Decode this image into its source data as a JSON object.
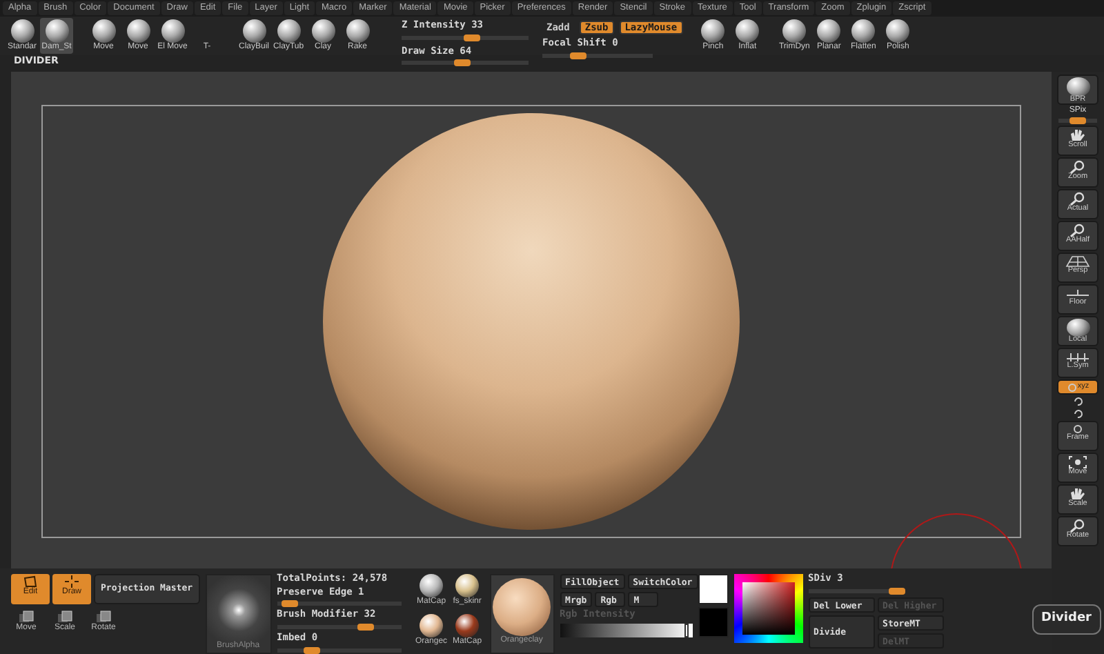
{
  "menu": [
    "Alpha",
    "Brush",
    "Color",
    "Document",
    "Draw",
    "Edit",
    "File",
    "Layer",
    "Light",
    "Macro",
    "Marker",
    "Material",
    "Movie",
    "Picker",
    "Preferences",
    "Render",
    "Stencil",
    "Stroke",
    "Texture",
    "Tool",
    "Transform",
    "Zoom",
    "Zplugin",
    "Zscript"
  ],
  "toolbar": {
    "brushes_left": [
      [
        {
          "label": "Standar",
          "selected": false,
          "kind": "sphere"
        },
        {
          "label": "Dam_St",
          "selected": true,
          "kind": "sphere"
        }
      ],
      [
        {
          "label": "Move",
          "selected": false,
          "kind": "sphere"
        },
        {
          "label": "Move",
          "selected": false,
          "kind": "sphere"
        },
        {
          "label": "El Move",
          "selected": false,
          "kind": "sphere"
        },
        {
          "label": "T-",
          "selected": false,
          "kind": "none"
        }
      ],
      [
        {
          "label": "ClayBuil",
          "selected": false,
          "kind": "sphere"
        },
        {
          "label": "ClayTub",
          "selected": false,
          "kind": "sphere"
        },
        {
          "label": "Clay",
          "selected": false,
          "kind": "sphere"
        },
        {
          "label": "Rake",
          "selected": false,
          "kind": "sphere"
        }
      ]
    ],
    "sliders": [
      {
        "label": "Z Intensity 33",
        "level": 0.56
      },
      {
        "label": "Draw Size 64",
        "level": 0.48
      }
    ],
    "toggles": [
      {
        "label": "Zadd",
        "on": false
      },
      {
        "label": "Zsub",
        "on": true
      },
      {
        "label": "LazyMouse",
        "on": true
      }
    ],
    "focal": {
      "label": "Focal Shift 0",
      "level": 0.3
    },
    "brushes_right": [
      [
        {
          "label": "Pinch",
          "selected": false,
          "kind": "sphere"
        },
        {
          "label": "Inflat",
          "selected": false,
          "kind": "sphere"
        }
      ],
      [
        {
          "label": "TrimDyn",
          "selected": false,
          "kind": "sphere"
        },
        {
          "label": "Planar",
          "selected": false,
          "kind": "sphere"
        },
        {
          "label": "Flatten",
          "selected": false,
          "kind": "sphere"
        },
        {
          "label": "Polish",
          "selected": false,
          "kind": "sphere"
        }
      ]
    ]
  },
  "divider_title": "DIVIDER",
  "right_shelf": [
    {
      "label": "BPR",
      "kind": "button"
    },
    {
      "label": "SPix",
      "kind": "slider",
      "level": 0.5
    },
    {
      "label": "Scroll",
      "kind": "button"
    },
    {
      "label": "Zoom",
      "kind": "button"
    },
    {
      "label": "Actual",
      "kind": "button"
    },
    {
      "label": "AAHalf",
      "kind": "button"
    },
    {
      "label": "Persp",
      "kind": "button"
    },
    {
      "label": "Floor",
      "kind": "button"
    },
    {
      "label": "Local",
      "kind": "button"
    },
    {
      "label": "L.Sym",
      "kind": "button"
    },
    {
      "label": "xyz",
      "kind": "toggle",
      "on": true
    },
    {
      "kind": "icon"
    },
    {
      "kind": "icon"
    },
    {
      "label": "Frame",
      "kind": "button"
    },
    {
      "label": "Move",
      "kind": "button"
    },
    {
      "label": "Scale",
      "kind": "button"
    },
    {
      "label": "Rotate",
      "kind": "button"
    }
  ],
  "tooltip": "Divider",
  "bottom": {
    "edit_modes": [
      {
        "label": "Edit",
        "on": true
      },
      {
        "label": "Draw",
        "on": true
      }
    ],
    "projection_master": "Projection Master",
    "transform_buttons": [
      "Move",
      "Scale",
      "Rotate"
    ],
    "brush_alpha": "BrushAlpha",
    "total_points": "TotalPoints: 24,578",
    "sliders": [
      {
        "label": "Preserve Edge 1",
        "level": 0.05
      },
      {
        "label": "Brush Modifier 32",
        "level": 0.75
      },
      {
        "label": "Imbed 0",
        "level": 0.25
      }
    ],
    "materials": [
      {
        "label": "MatCap",
        "color": "#b8b8b8"
      },
      {
        "label": "fs_skinr",
        "color": "#d8c08c"
      },
      {
        "label": "Orangec",
        "color": "#e2b892"
      },
      {
        "label": "MatCap",
        "color": "#9a3a1c"
      }
    ],
    "current_material": "Orangeclay",
    "color_buttons": [
      "FillObject",
      "SwitchColor"
    ],
    "channels": [
      "Mrgb",
      "Rgb",
      "M"
    ],
    "rgb_intensity": {
      "label": "Rgb Intensity",
      "disabled": true,
      "level": 0.97
    },
    "swatches": [
      {
        "color": "#ffffff"
      },
      {
        "color": "#000000"
      }
    ],
    "sdiv": {
      "label": "SDiv 3",
      "level": 1
    },
    "geometry_buttons": [
      {
        "label": "Del Lower",
        "disabled": false
      },
      {
        "label": "Divide",
        "disabled": false
      },
      {
        "label": "Del Higher",
        "disabled": true
      },
      {
        "label": "StoreMT",
        "disabled": false
      },
      {
        "label": "DelMT",
        "disabled": true
      }
    ]
  }
}
